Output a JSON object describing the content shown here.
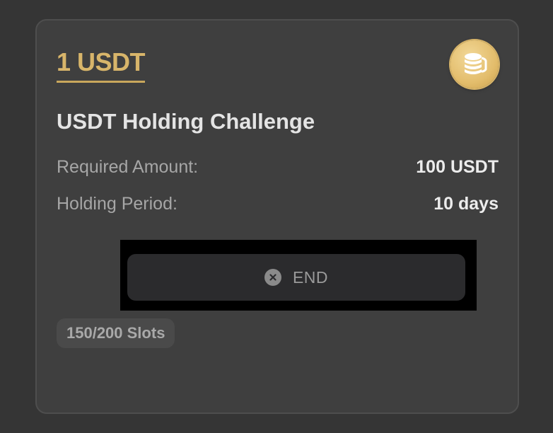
{
  "card": {
    "reward": "1 USDT",
    "title": "USDT Holding Challenge",
    "rows": [
      {
        "label": "Required Amount:",
        "value": "100 USDT"
      },
      {
        "label": "Holding Period:",
        "value": "10 days"
      }
    ],
    "status_button": {
      "label": "END",
      "icon": "close-circle-icon"
    },
    "slots": "150/200 Slots",
    "badge_icon": "coins-stack-icon"
  },
  "colors": {
    "page_background": "#353535",
    "card_background": "#3f3f3f",
    "accent_gold": "#d8b56a",
    "button_background": "#2b2b2d"
  }
}
